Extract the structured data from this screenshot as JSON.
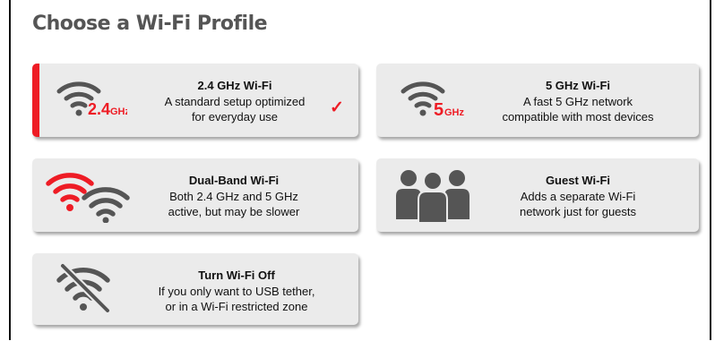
{
  "page": {
    "title": "Choose a Wi-Fi Profile"
  },
  "profiles": [
    {
      "name": "2.4 GHz Wi-Fi",
      "desc_line1": "A standard setup optimized",
      "desc_line2": "for everyday use",
      "badge": "2.4",
      "badge_unit": "GHz",
      "selected": true,
      "icon": "wifi-24ghz-icon"
    },
    {
      "name": "5 GHz Wi-Fi",
      "desc_line1": "A fast 5 GHz network",
      "desc_line2": "compatible with most devices",
      "badge": "5",
      "badge_unit": "GHz",
      "selected": false,
      "icon": "wifi-5ghz-icon"
    },
    {
      "name": "Dual-Band Wi-Fi",
      "desc_line1": "Both 2.4 GHz and 5 GHz",
      "desc_line2": "active, but may be slower",
      "selected": false,
      "icon": "dual-band-wifi-icon"
    },
    {
      "name": "Guest Wi-Fi",
      "desc_line1": "Adds a separate Wi-Fi",
      "desc_line2": "network just for guests",
      "selected": false,
      "icon": "guests-group-icon"
    },
    {
      "name": "Turn Wi-Fi Off",
      "desc_line1": "If you only want to USB tether,",
      "desc_line2": "or in a Wi-Fi restricted zone",
      "selected": false,
      "icon": "wifi-off-icon"
    }
  ],
  "selected_mark": "✓",
  "colors": {
    "accent": "#ee1c25",
    "card_bg": "#ebebeb",
    "icon_gray": "#555555",
    "title": "#555555"
  }
}
